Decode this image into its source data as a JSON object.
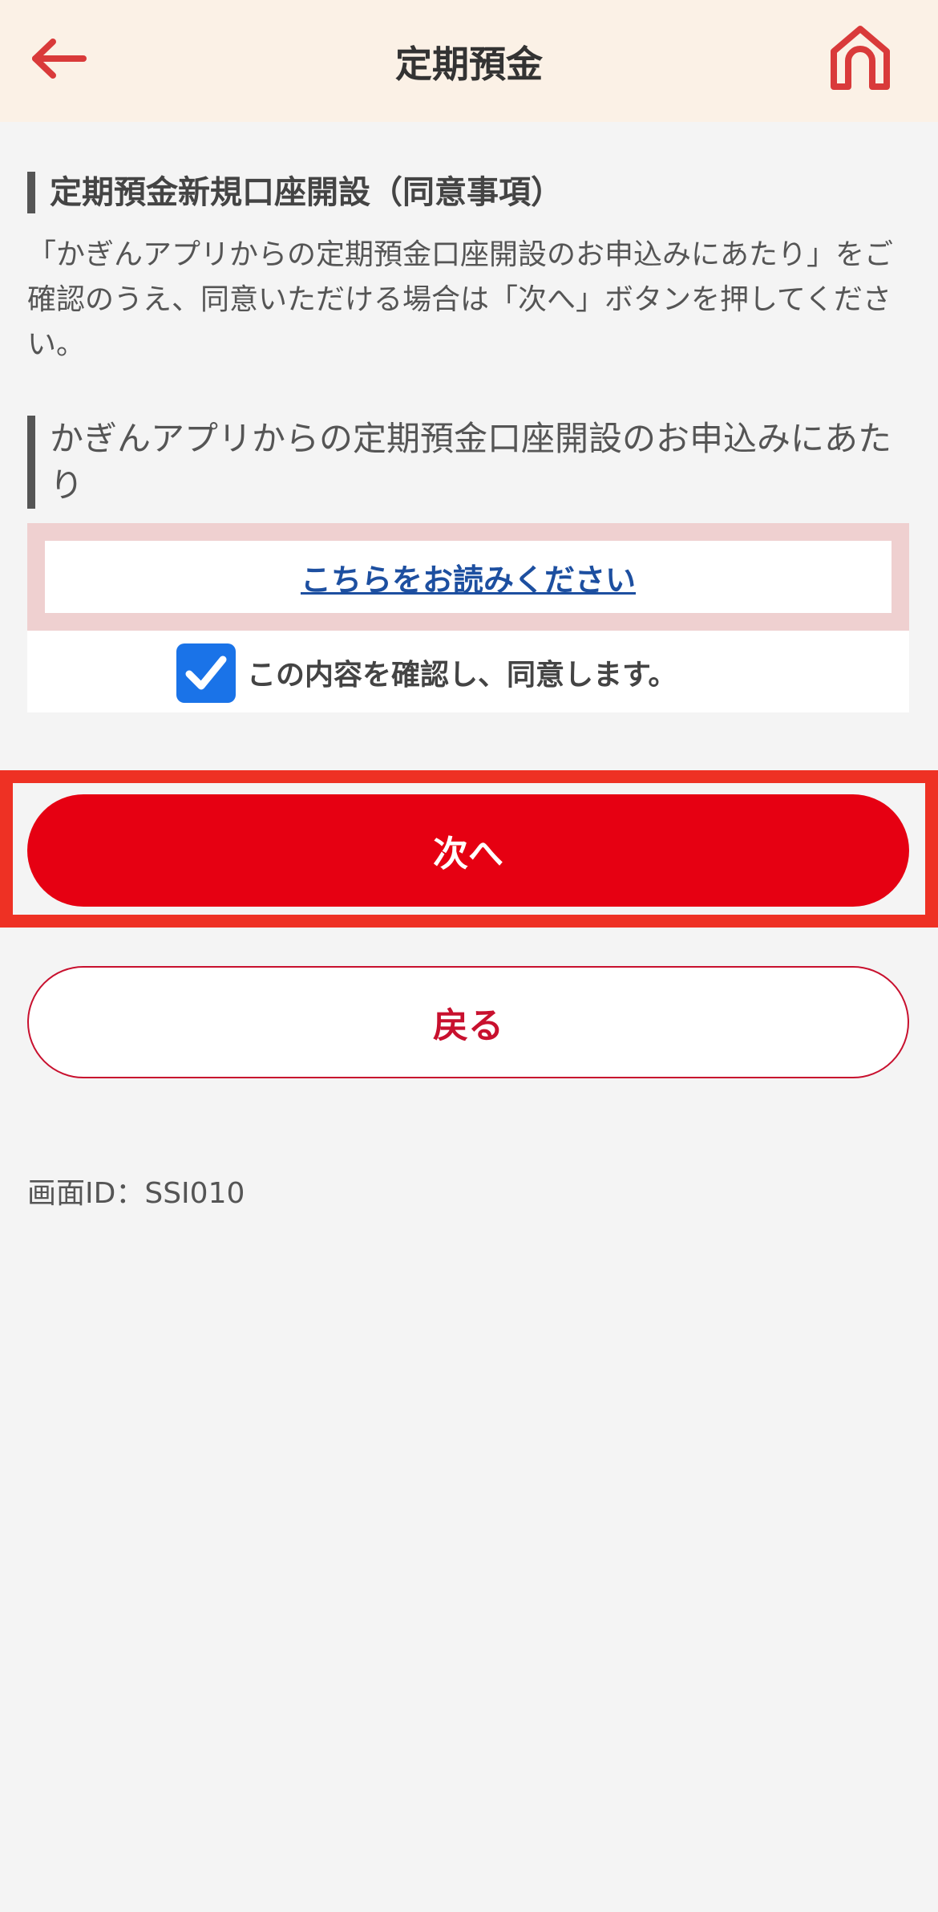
{
  "header": {
    "title": "定期預金",
    "back_icon": "arrow-left-icon",
    "home_icon": "home-icon"
  },
  "section": {
    "title": "定期預金新規口座開設（同意事項）",
    "description": "「かぎんアプリからの定期預金口座開設のお申込みにあたり」をご確認のうえ、同意いただける場合は「次へ」ボタンを押してください。"
  },
  "terms": {
    "title": "かぎんアプリからの定期預金口座開設のお申込みにあたり",
    "link_label": "こちらをお読みください",
    "agree_label": "この内容を確認し、同意します。",
    "agree_checked": true
  },
  "buttons": {
    "next_label": "次へ",
    "back_label": "戻る"
  },
  "footer": {
    "screen_id": "画面ID：SSI010"
  },
  "colors": {
    "accent": "#e60012",
    "header_bg": "#fbf1e6",
    "checkbox": "#1a73e8",
    "link": "#1d4fa0"
  }
}
